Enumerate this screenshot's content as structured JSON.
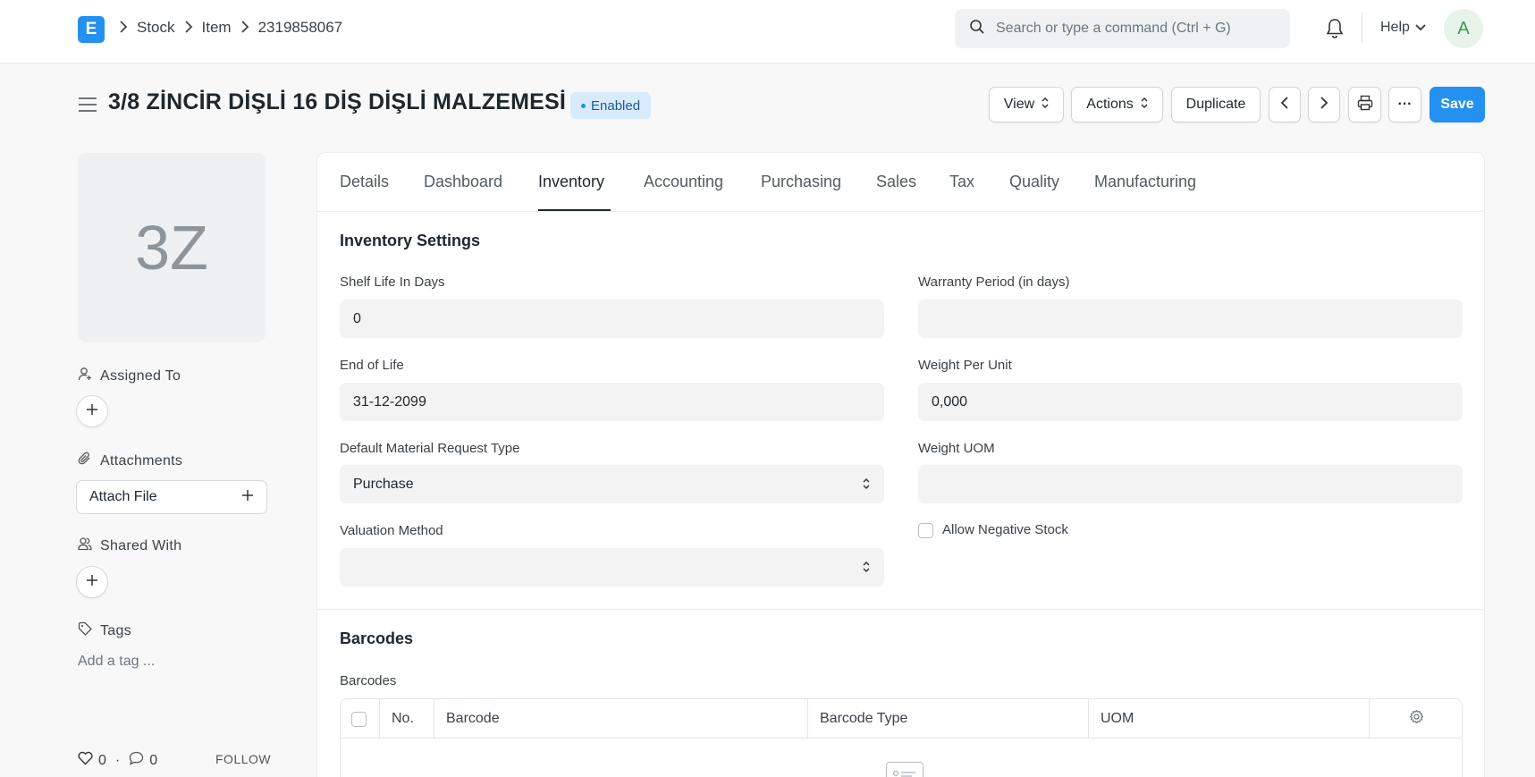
{
  "navbar": {
    "logo_letter": "E",
    "breadcrumbs": [
      "Stock",
      "Item",
      "2319858067"
    ],
    "search_placeholder": "Search or type a command (Ctrl + G)",
    "help_label": "Help",
    "avatar_initial": "A"
  },
  "header": {
    "title": "3/8 ZİNCİR DİŞLİ 16 DİŞ DİŞLİ MALZEMESİ",
    "status": "Enabled",
    "buttons": {
      "view": "View",
      "actions": "Actions",
      "duplicate": "Duplicate",
      "more": "···",
      "save": "Save"
    }
  },
  "sidebar": {
    "image_initials": "3Z",
    "assigned_to": "Assigned To",
    "attachments": "Attachments",
    "attach_file": "Attach File",
    "shared_with": "Shared With",
    "tags": "Tags",
    "add_tag": "Add a tag ...",
    "likes": "0",
    "comments": "0",
    "follow": "FOLLOW"
  },
  "tabs": [
    "Details",
    "Dashboard",
    "Inventory",
    "Accounting",
    "Purchasing",
    "Sales",
    "Tax",
    "Quality",
    "Manufacturing"
  ],
  "active_tab": "Inventory",
  "inventory": {
    "section_title": "Inventory Settings",
    "shelf_life_label": "Shelf Life In Days",
    "shelf_life_value": "0",
    "warranty_label": "Warranty Period (in days)",
    "warranty_value": "",
    "end_of_life_label": "End of Life",
    "end_of_life_value": "31-12-2099",
    "weight_per_unit_label": "Weight Per Unit",
    "weight_per_unit_value": "0,000",
    "material_request_label": "Default Material Request Type",
    "material_request_value": "Purchase",
    "weight_uom_label": "Weight UOM",
    "weight_uom_value": "",
    "valuation_label": "Valuation Method",
    "valuation_value": "",
    "allow_negative_label": "Allow Negative Stock",
    "allow_negative_checked": false
  },
  "barcodes": {
    "section_title": "Barcodes",
    "table_label": "Barcodes",
    "columns": [
      "No.",
      "Barcode",
      "Barcode Type",
      "UOM"
    ]
  }
}
